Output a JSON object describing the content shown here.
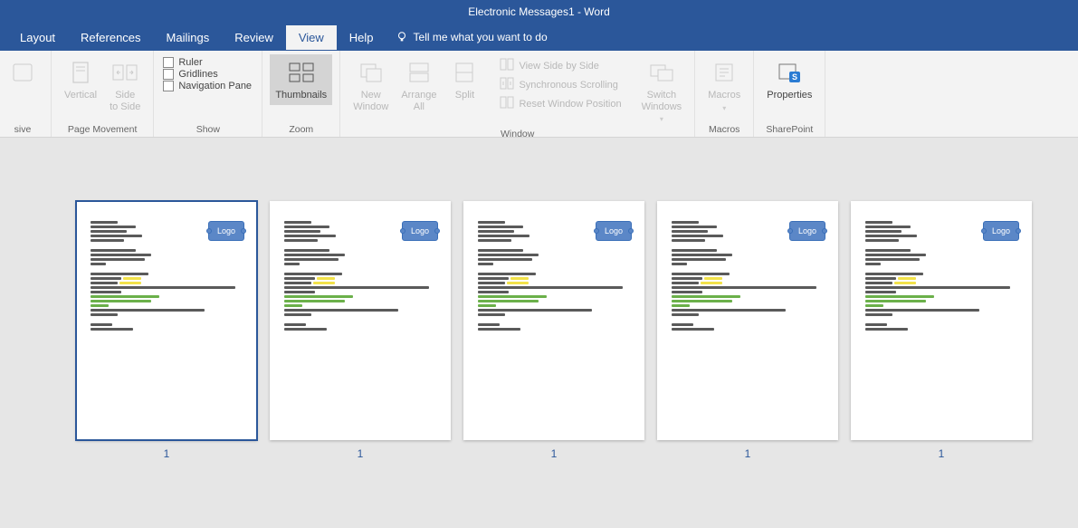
{
  "title": "Electronic Messages1  -  Word",
  "menu": {
    "layout": "Layout",
    "references": "References",
    "mailings": "Mailings",
    "review": "Review",
    "view": "View",
    "help": "Help",
    "tell_me": "Tell me what you want to do"
  },
  "ribbon": {
    "page_movement": {
      "label": "Page Movement",
      "vertical": "Vertical",
      "side_to_side": "Side\nto Side"
    },
    "show": {
      "label": "Show",
      "ruler": "Ruler",
      "gridlines": "Gridlines",
      "navigation_pane": "Navigation Pane"
    },
    "zoom": {
      "label": "Zoom",
      "thumbnails": "Thumbnails"
    },
    "window": {
      "label": "Window",
      "new_window": "New\nWindow",
      "arrange_all": "Arrange\nAll",
      "split": "Split",
      "view_side": "View Side by Side",
      "sync_scroll": "Synchronous Scrolling",
      "reset_pos": "Reset Window Position",
      "switch_windows": "Switch\nWindows"
    },
    "macros": {
      "label": "Macros",
      "macros": "Macros"
    },
    "sharepoint": {
      "label": "SharePoint",
      "properties": "Properties"
    },
    "sive": "sive"
  },
  "logo_text": "Logo",
  "pages": [
    {
      "num": "1"
    },
    {
      "num": "1"
    },
    {
      "num": "1"
    },
    {
      "num": "1"
    },
    {
      "num": "1"
    }
  ]
}
